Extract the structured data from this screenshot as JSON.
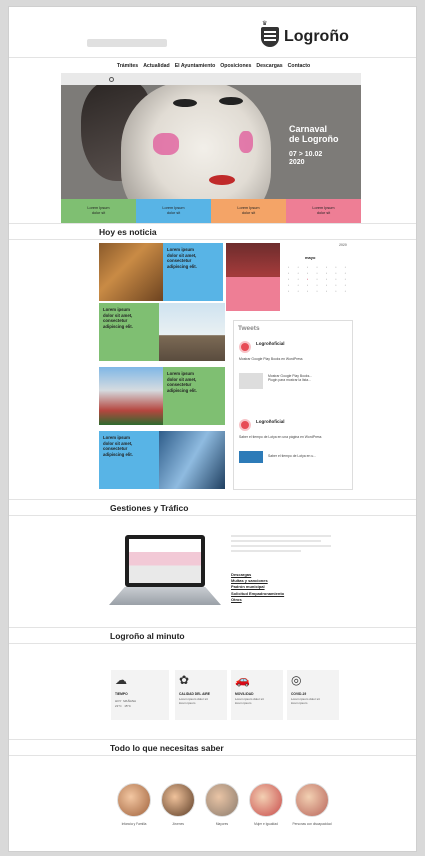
{
  "header": {
    "logo_text": "Logroño",
    "nav": [
      "Trámites",
      "Actualidad",
      "El Ayuntamiento",
      "Oposiciones",
      "Descargas",
      "Contacto"
    ]
  },
  "hero": {
    "title": "Carnaval\nde Logroño",
    "date": "07 > 10.02\n2020",
    "tiles": [
      {
        "text": "Lorem Ipsum\ndolor sit",
        "color": "#7fbf72"
      },
      {
        "text": "Lorem Ipsum\ndolor sit",
        "color": "#58b4e6"
      },
      {
        "text": "Lorem Ipsum\ndolor sit",
        "color": "#f4a467"
      },
      {
        "text": "Lorem Ipsum\ndolor sit",
        "color": "#ee7e95"
      }
    ]
  },
  "news": {
    "title": "Hoy es noticia",
    "card_text": "Lorem ipsum\ndolor sit amet,\nconsectetur\nadipiscing elit.",
    "calendar": {
      "year": "2020",
      "month": "mayo"
    },
    "tweets": {
      "title": "Tweets",
      "handle": "Logroñoficial",
      "text1": "Mostrar Google Play Books en WordPress",
      "text2": "Mostrar Google Play Books...\nPlugin para mostrar la lista...",
      "text3": "Saber el tiempo de Lotya en una página en WordPress",
      "text4": "Saber el tiempo de Lotya en u..."
    }
  },
  "gestiones": {
    "title": "Gestiones y Tráfico",
    "links": [
      "Descargas",
      "Multas y sanciones",
      "Padrón municipal",
      "Solicitud Empadronamiento",
      "Otros"
    ]
  },
  "minuto": {
    "title": "Logroño al minuto",
    "tiempo": "TIEMPO",
    "items": [
      {
        "label": "CALIDAD DEL AIRE",
        "text": "Lorem ipsum dolor sit\nlorem ipsum"
      },
      {
        "label": "MOVILIDAD",
        "text": "Lorem ipsum dolor sit\nlorem ipsum"
      },
      {
        "label": "COVID-19",
        "text": "Lorem ipsum dolor sit\nlorem ipsum"
      }
    ],
    "temps": [
      {
        "label": "HOY",
        "value": "21°C"
      },
      {
        "label": "MAÑANA",
        "value": "15°C"
      }
    ]
  },
  "saber": {
    "title": "Todo lo que necesitas saber",
    "items": [
      "Infancia y Familia",
      "Jóvenes",
      "Mayores",
      "Mujer e Igualdad",
      "Personas con discapacidad"
    ]
  }
}
